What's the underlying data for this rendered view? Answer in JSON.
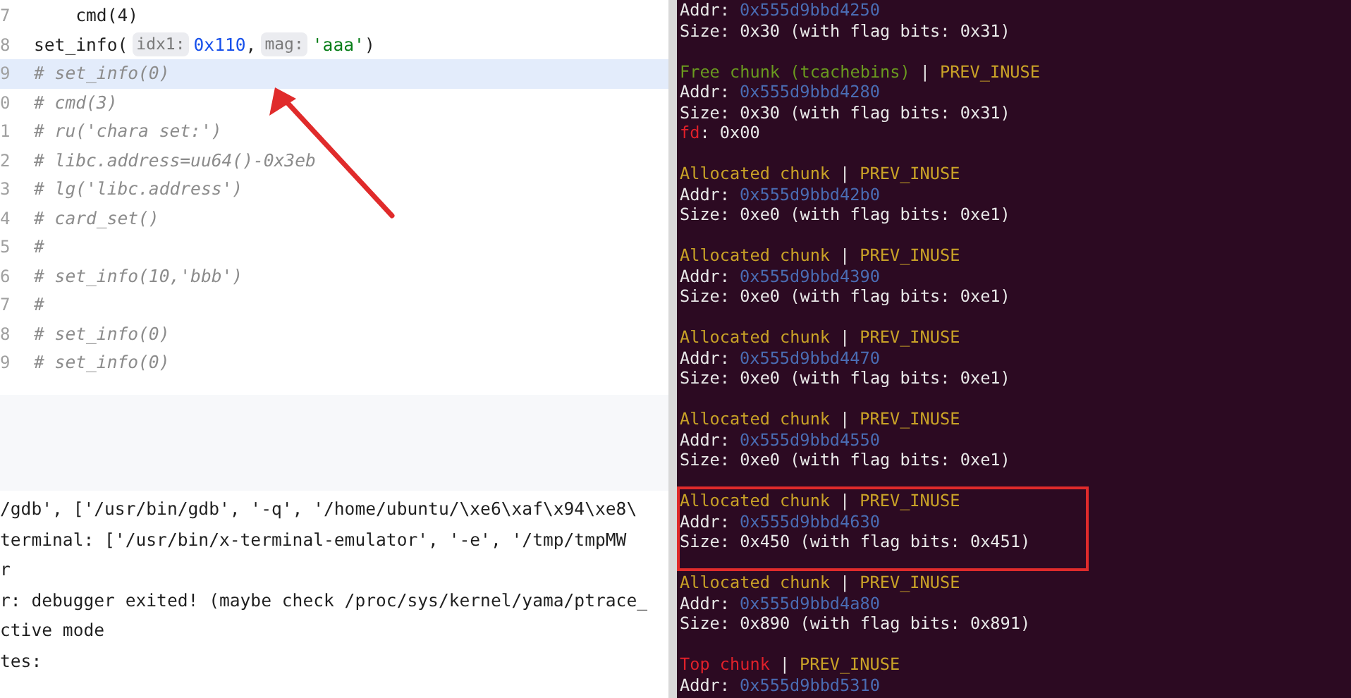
{
  "editor": {
    "lines": [
      {
        "number": "7",
        "current": false,
        "tokens": [
          {
            "kind": "plain",
            "text": "    cmd(4)"
          }
        ]
      },
      {
        "number": "8",
        "current": false,
        "tokens": [
          {
            "kind": "plain",
            "text": "set_info("
          },
          {
            "kind": "hint",
            "text": "idx1:"
          },
          {
            "kind": "number",
            "text": "0x110"
          },
          {
            "kind": "plain",
            "text": ","
          },
          {
            "kind": "hint",
            "text": "mag:"
          },
          {
            "kind": "string",
            "text": "'aaa'"
          },
          {
            "kind": "plain",
            "text": ")"
          }
        ]
      },
      {
        "number": "9",
        "current": true,
        "tokens": [
          {
            "kind": "comment",
            "text": "# set_info(0)"
          }
        ]
      },
      {
        "number": "0",
        "current": false,
        "tokens": [
          {
            "kind": "comment",
            "text": "# cmd(3)"
          }
        ]
      },
      {
        "number": "1",
        "current": false,
        "tokens": [
          {
            "kind": "comment",
            "text": "# ru('chara set:')"
          }
        ]
      },
      {
        "number": "2",
        "current": false,
        "tokens": [
          {
            "kind": "comment",
            "text": "# libc.address=uu64()-0x3eb"
          }
        ]
      },
      {
        "number": "3",
        "current": false,
        "tokens": [
          {
            "kind": "comment",
            "text": "# lg('libc.address')"
          }
        ]
      },
      {
        "number": "4",
        "current": false,
        "tokens": [
          {
            "kind": "comment",
            "text": "# card_set()"
          }
        ]
      },
      {
        "number": "5",
        "current": false,
        "tokens": [
          {
            "kind": "comment",
            "text": "#"
          }
        ]
      },
      {
        "number": "6",
        "current": false,
        "tokens": [
          {
            "kind": "comment",
            "text": "# set_info(10,'bbb')"
          }
        ]
      },
      {
        "number": "7",
        "current": false,
        "tokens": [
          {
            "kind": "comment",
            "text": "#"
          }
        ]
      },
      {
        "number": "8",
        "current": false,
        "tokens": [
          {
            "kind": "comment",
            "text": "# set_info(0)"
          }
        ]
      },
      {
        "number": "9",
        "current": false,
        "tokens": [
          {
            "kind": "comment",
            "text": "# set_info(0)"
          }
        ]
      }
    ]
  },
  "console": {
    "lines": [
      "/gdb', ['/usr/bin/gdb', '-q', '/home/ubuntu/\\xe6\\xaf\\x94\\xe8\\",
      "terminal: ['/usr/bin/x-terminal-emulator', '-e', '/tmp/tmpMW",
      "r",
      "r: debugger exited! (maybe check /proc/sys/kernel/yama/ptrace_",
      "ctive mode",
      "tes:"
    ]
  },
  "heap": {
    "chunks": [
      {
        "highlighted": false,
        "addr": {
          "label": "Addr:",
          "value": "0x555d9bbd4250"
        },
        "size": "Size: 0x30 (with flag bits: 0x31)"
      },
      {
        "kind": "free",
        "highlighted": false,
        "title": "Free chunk (tcachebins)",
        "separator": "|",
        "flag": "PREV_INUSE",
        "addr": {
          "label": "Addr:",
          "value": "0x555d9bbd4280"
        },
        "size": "Size: 0x30 (with flag bits: 0x31)",
        "fd": {
          "label": "fd",
          "rest": ": 0x00"
        }
      },
      {
        "kind": "allocated",
        "highlighted": false,
        "title": "Allocated chunk",
        "separator": "|",
        "flag": "PREV_INUSE",
        "addr": {
          "label": "Addr:",
          "value": "0x555d9bbd42b0"
        },
        "size": "Size: 0xe0 (with flag bits: 0xe1)"
      },
      {
        "kind": "allocated",
        "highlighted": false,
        "title": "Allocated chunk",
        "separator": "|",
        "flag": "PREV_INUSE",
        "addr": {
          "label": "Addr:",
          "value": "0x555d9bbd4390"
        },
        "size": "Size: 0xe0 (with flag bits: 0xe1)"
      },
      {
        "kind": "allocated",
        "highlighted": false,
        "title": "Allocated chunk",
        "separator": "|",
        "flag": "PREV_INUSE",
        "addr": {
          "label": "Addr:",
          "value": "0x555d9bbd4470"
        },
        "size": "Size: 0xe0 (with flag bits: 0xe1)"
      },
      {
        "kind": "allocated",
        "highlighted": false,
        "title": "Allocated chunk",
        "separator": "|",
        "flag": "PREV_INUSE",
        "addr": {
          "label": "Addr:",
          "value": "0x555d9bbd4550"
        },
        "size": "Size: 0xe0 (with flag bits: 0xe1)"
      },
      {
        "kind": "allocated",
        "highlighted": true,
        "title": "Allocated chunk",
        "separator": "|",
        "flag": "PREV_INUSE",
        "addr": {
          "label": "Addr:",
          "value": "0x555d9bbd4630"
        },
        "size": "Size: 0x450 (with flag bits: 0x451)"
      },
      {
        "kind": "allocated",
        "highlighted": false,
        "title": "Allocated chunk",
        "separator": "|",
        "flag": "PREV_INUSE",
        "addr": {
          "label": "Addr:",
          "value": "0x555d9bbd4a80"
        },
        "size": "Size: 0x890 (with flag bits: 0x891)"
      },
      {
        "kind": "top",
        "highlighted": false,
        "title": "Top chunk",
        "separator": "|",
        "flag": "PREV_INUSE",
        "addr": {
          "label": "Addr:",
          "value": "0x555d9bbd5310"
        }
      }
    ]
  }
}
